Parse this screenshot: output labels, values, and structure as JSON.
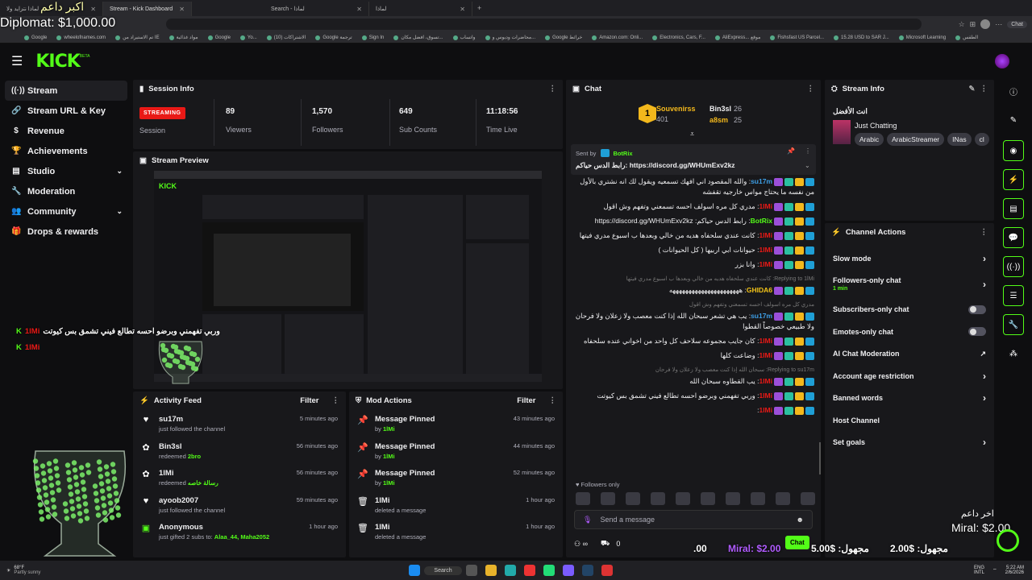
{
  "browser": {
    "tabs": [
      {
        "label": "لماذا نتزايد ولا"
      },
      {
        "label": "Stream - Kick Dashboard"
      },
      {
        "label": "Search - لماذا"
      },
      {
        "label": "لماذا"
      }
    ],
    "bookmarks": [
      "Google",
      "wheelofnames.com",
      "تم الاستيراد من IE",
      "مواد غذائية",
      "Google",
      "Yo...",
      "(10) الاشتراكات",
      "Google ترجمة",
      "Sign In",
      "تسوق، افضل مكان...",
      "واتساب",
      "محاضرات وديوس و...",
      "Google خرائط",
      "Amazon.com: Onli...",
      "Electronics, Cars, F...",
      "AliExpress... موقع",
      "Fishsfast US Parcel...",
      "15.28 USD to SAR J...",
      "Microsoft Learning",
      "الطقس"
    ],
    "profile": "Chat"
  },
  "overlay": {
    "diplomat": "Diplomat: $1,000.00",
    "last_top": "اكبر داعم",
    "last_label": "اخر داعم",
    "last_value": "Miral: $2.00",
    "ticker": [
      ".00",
      "Miral: $2.00",
      "5.00$ :مجهول",
      "2.00$ :مجهول"
    ],
    "float_msg": "وربي تفهمني وبرضو احسه تطالع فيني تشمق بس كيوتت",
    "float_user1": "1lMi",
    "float_user2": "1lMi"
  },
  "kick": {
    "logo": "KICK",
    "beta": "BETA"
  },
  "sidebar": {
    "items": [
      {
        "label": "Stream",
        "icon": "stream-icon"
      },
      {
        "label": "Stream URL & Key",
        "icon": "link-icon"
      },
      {
        "label": "Revenue",
        "icon": "dollar-icon"
      },
      {
        "label": "Achievements",
        "icon": "trophy-icon"
      },
      {
        "label": "Studio",
        "icon": "studio-icon"
      },
      {
        "label": "Moderation",
        "icon": "wrench-icon"
      },
      {
        "label": "Community",
        "icon": "people-icon"
      },
      {
        "label": "Drops & rewards",
        "icon": "gift-icon"
      }
    ]
  },
  "session": {
    "title": "Session Info",
    "status": "STREAMING",
    "status_label": "Session",
    "stats": [
      {
        "value": "89",
        "label": "Viewers"
      },
      {
        "value": "1,570",
        "label": "Followers"
      },
      {
        "value": "649",
        "label": "Sub Counts"
      },
      {
        "value": "11:18:56",
        "label": "Time Live"
      }
    ]
  },
  "preview": {
    "title": "Stream Preview"
  },
  "activity": {
    "title": "Activity Feed",
    "filter": "Filter",
    "items": [
      {
        "icon": "heart-icon",
        "name": "su17m",
        "sub": "just followed the channel",
        "time": "5 minutes ago"
      },
      {
        "icon": "redeem-icon",
        "name": "Bin3sl",
        "sub_pre": "redeemed ",
        "sub_b": "2bro",
        "time": "56 minutes ago"
      },
      {
        "icon": "redeem-icon",
        "name": "1lMi",
        "sub_pre": "redeemed ",
        "sub_b": "رسالة خاصه",
        "time": "56 minutes ago"
      },
      {
        "icon": "heart-icon",
        "name": "ayoob2007",
        "sub": "just followed the channel",
        "time": "59 minutes ago"
      },
      {
        "icon": "gift-icon",
        "name": "Anonymous",
        "sub_pre": "just gifted 2 subs to: ",
        "sub_b": "Alaa_44, Maha2052",
        "time": "1 hour ago"
      }
    ]
  },
  "modactions": {
    "title": "Mod Actions",
    "filter": "Filter",
    "items": [
      {
        "icon": "pin-icon",
        "name": "Message Pinned",
        "by": "by ",
        "who": "1lMi",
        "time": "43 minutes ago"
      },
      {
        "icon": "pin-icon",
        "name": "Message Pinned",
        "by": "by ",
        "who": "1lMi",
        "time": "44 minutes ago"
      },
      {
        "icon": "pin-icon",
        "name": "Message Pinned",
        "by": "by ",
        "who": "1lMi",
        "time": "52 minutes ago"
      },
      {
        "icon": "trash-icon",
        "name": "1lMi",
        "by": "deleted a message",
        "who": "",
        "time": "1 hour ago"
      },
      {
        "icon": "trash-icon",
        "name": "1lMi",
        "by": "deleted a message",
        "who": "",
        "time": "1 hour ago"
      }
    ]
  },
  "chat": {
    "title": "Chat",
    "top_gifters": [
      {
        "name": "Souvenirss",
        "count": "401"
      },
      {
        "name": "Bin3sl",
        "count": "26"
      },
      {
        "name": "a8sm",
        "count": "25"
      }
    ],
    "pinned_by": "Sent by",
    "pinned_user": "BotRix",
    "pinned_text": "رابط الدس حياكم: https://discord.gg/WHUmExv2kz",
    "messages": [
      {
        "type": "msg",
        "user": "su17m",
        "color": "#3d9ee5",
        "text": "والله المقصود اني افهك تسمعيه ويقول لك انه نشتري بالأول من نفسه ما يحتاج مواس خارجيه تقفشه"
      },
      {
        "type": "msg",
        "user": "1lMi",
        "color": "#e91916",
        "text": "مدري كل مره اسولف احسه تسمعني وتفهم وش اقول"
      },
      {
        "type": "msg",
        "user": "BotRix",
        "color": "#53fc18",
        "text": "رابط الدس حياكم: https://discord.gg/WHUmExv2kz"
      },
      {
        "type": "msg",
        "user": "1lMi",
        "color": "#e91916",
        "text": "كانت عندي سلحفاه هديه من خالي وبعدها ب اسبوع مدري فيتها"
      },
      {
        "type": "msg",
        "user": "1lMi",
        "color": "#e91916",
        "text": "حيوانات ابي اربيها ( كل الحيوانات )"
      },
      {
        "type": "msg",
        "user": "1lMi",
        "color": "#e91916",
        "text": "وانا بزر"
      },
      {
        "type": "reply",
        "text": "Replying to 1lMi: كانت عندي سلحفاه هديه من خالي وبعدها ب اسبوع مدري فيتها"
      },
      {
        "type": "msg",
        "user": "GHIDA6",
        "color": "#f5c518",
        "text": "ههههههههههههههههههههههه"
      },
      {
        "type": "reply",
        "text": "مدري كل مره اسولف احسه تسمعني وتفهم وش اقول"
      },
      {
        "type": "msg",
        "user": "su17m",
        "color": "#3d9ee5",
        "text": "يب هي تشعر سبحان الله إذا كنت معصب ولا زعلان ولا فرحان ولا طبيعي خصوصاً القطوا"
      },
      {
        "type": "msg",
        "user": "1lMi",
        "color": "#e91916",
        "text": "كان جايب مجموعه سلاحف كل واحد من اخواني عنده سلحفاه"
      },
      {
        "type": "msg",
        "user": "1lMi",
        "color": "#e91916",
        "text": "وضاعت كلها"
      },
      {
        "type": "reply",
        "text": "Replying to su17m: سبحان الله إذا كنت معصب ولا زعلان ولا فرحان"
      },
      {
        "type": "msg",
        "user": "1lMi",
        "color": "#e91916",
        "text": "يب القطاوه سبحان الله"
      },
      {
        "type": "msg",
        "user": "1lMi",
        "color": "#e91916",
        "text": "وربي تفهمني وبرضو احسه تطالع فيني تشمق بس كيوتت"
      },
      {
        "type": "msg",
        "user": "1lMi",
        "color": "#e91916",
        "text": ""
      }
    ],
    "followers_only": "Followers only",
    "send_placeholder": "Send a message",
    "bottom_count": "0",
    "chat_button": "Chat"
  },
  "streaminfo": {
    "title": "Stream Info",
    "stream_title": "انت الأفضل",
    "category": "Just Chatting",
    "tags": [
      "Arabic",
      "ArabicStreamer",
      "INas",
      "cl"
    ]
  },
  "channelactions": {
    "title": "Channel Actions",
    "items": [
      {
        "label": "Slow mode",
        "kind": "chev"
      },
      {
        "label": "Followers-only chat",
        "sub": "1 min",
        "kind": "chev"
      },
      {
        "label": "Subscribers-only chat",
        "kind": "toggle"
      },
      {
        "label": "Emotes-only chat",
        "kind": "toggle"
      },
      {
        "label": "AI Chat Moderation",
        "kind": "ext"
      },
      {
        "label": "Account age restriction",
        "kind": "chev"
      },
      {
        "label": "Banned words",
        "kind": "chev"
      },
      {
        "label": "Host Channel",
        "kind": "none"
      },
      {
        "label": "Set goals",
        "kind": "chev"
      }
    ]
  },
  "taskbar": {
    "weather": "68°F",
    "weather_sub": "Partly sunny",
    "search": "Search",
    "lang": "ENG",
    "lang_sub": "INTL",
    "time": "5:22 AM",
    "date": "2/6/2026"
  },
  "colors": {
    "kick_green": "#53fc18",
    "live_red": "#e91916",
    "panel": "#18181b",
    "bg": "#0e0e10"
  }
}
